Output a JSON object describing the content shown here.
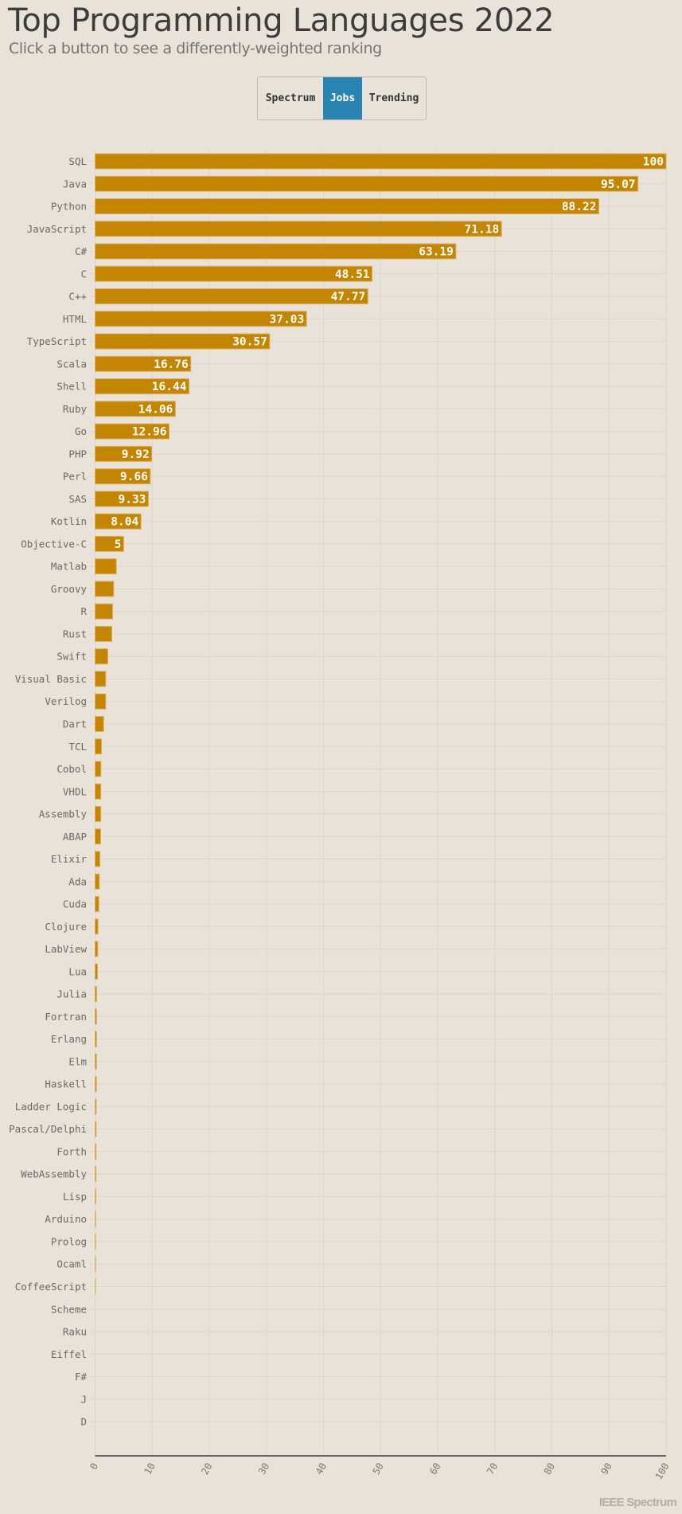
{
  "header": {
    "title": "Top Programming Languages 2022",
    "subtitle": "Click a button to see a differently-weighted ranking"
  },
  "buttons": [
    {
      "label": "Spectrum",
      "active": false
    },
    {
      "label": "Jobs",
      "active": true
    },
    {
      "label": "Trending",
      "active": false
    }
  ],
  "colors": {
    "background": "#e8e2d9",
    "bar": "#c48500",
    "bar_border": "#dcb060",
    "active_button": "#2a84b3",
    "grid": "#dad6d0",
    "axis": "#6a6866"
  },
  "brand": "IEEE Spectrum",
  "chart_data": {
    "type": "bar",
    "orientation": "horizontal",
    "title": "Top Programming Languages 2022",
    "xlabel": "",
    "ylabel": "",
    "xlim": [
      0,
      100
    ],
    "xticks": [
      0,
      10,
      20,
      30,
      40,
      50,
      60,
      70,
      80,
      90,
      100
    ],
    "grid": true,
    "categories": [
      "SQL",
      "Java",
      "Python",
      "JavaScript",
      "C#",
      "C",
      "C++",
      "HTML",
      "TypeScript",
      "Scala",
      "Shell",
      "Ruby",
      "Go",
      "PHP",
      "Perl",
      "SAS",
      "Kotlin",
      "Objective-C",
      "Matlab",
      "Groovy",
      "R",
      "Rust",
      "Swift",
      "Visual Basic",
      "Verilog",
      "Dart",
      "TCL",
      "Cobol",
      "VHDL",
      "Assembly",
      "ABAP",
      "Elixir",
      "Ada",
      "Cuda",
      "Clojure",
      "LabView",
      "Lua",
      "Julia",
      "Fortran",
      "Erlang",
      "Elm",
      "Haskell",
      "Ladder Logic",
      "Pascal/Delphi",
      "Forth",
      "WebAssembly",
      "Lisp",
      "Arduino",
      "Prolog",
      "Ocaml",
      "CoffeeScript",
      "Scheme",
      "Raku",
      "Eiffel",
      "F#",
      "J",
      "D"
    ],
    "values": [
      100,
      95.07,
      88.22,
      71.18,
      63.19,
      48.51,
      47.77,
      37.03,
      30.57,
      16.76,
      16.44,
      14.06,
      12.96,
      9.92,
      9.66,
      9.33,
      8.04,
      5,
      3.72,
      3.25,
      3.07,
      2.93,
      2.23,
      1.86,
      1.86,
      1.49,
      1.12,
      1.02,
      1.0,
      1.0,
      0.97,
      0.84,
      0.74,
      0.65,
      0.51,
      0.46,
      0.42,
      0.28,
      0.25,
      0.25,
      0.24,
      0.23,
      0.2,
      0.18,
      0.17,
      0.15,
      0.14,
      0.1,
      0.08,
      0.07,
      0.04,
      0,
      0,
      0,
      0,
      0,
      0
    ],
    "value_labels": [
      "100",
      "95.07",
      "88.22",
      "71.18",
      "63.19",
      "48.51",
      "47.77",
      "37.03",
      "30.57",
      "16.76",
      "16.44",
      "14.06",
      "12.96",
      "9.92",
      "9.66",
      "9.33",
      "8.04",
      "5",
      "",
      "",
      "",
      "",
      "",
      "",
      "",
      "",
      "",
      "",
      "",
      "",
      "",
      "",
      "",
      "",
      "",
      "",
      "",
      "",
      "",
      "",
      "",
      "",
      "",
      "",
      "",
      "",
      "",
      "",
      "",
      "",
      "",
      "",
      "",
      "",
      "",
      "",
      ""
    ]
  }
}
